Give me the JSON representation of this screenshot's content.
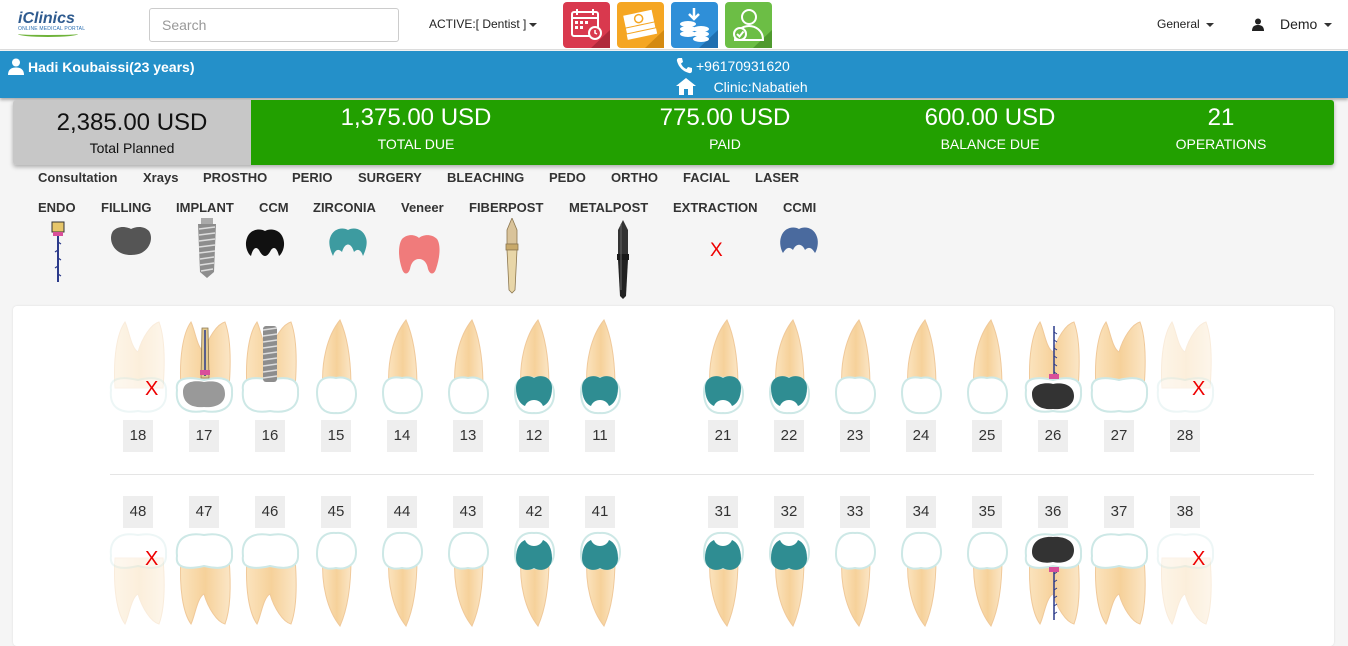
{
  "header": {
    "logo_brand": "iClinics",
    "logo_sub": "ONLINE MEDICAL PORTAL",
    "search_placeholder": "Search",
    "active_label": "ACTIVE:[ Dentist ]",
    "general_label": "General",
    "user_label": "Demo",
    "tiles": [
      {
        "name": "calendar",
        "color": "#d9394e"
      },
      {
        "name": "money",
        "color": "#f5a623"
      },
      {
        "name": "download-coins",
        "color": "#2f8fd8"
      },
      {
        "name": "user-check",
        "color": "#6cbe45"
      }
    ]
  },
  "patient": {
    "name": "Hadi Koubaissi(23 years)",
    "phone": "+96170931620",
    "clinic": "Clinic:Nabatieh"
  },
  "summary": {
    "total_planned_amount": "2,385.00 USD",
    "total_planned_label": "Total Planned",
    "cells": [
      {
        "amount": "1,375.00 USD",
        "label": "TOTAL DUE"
      },
      {
        "amount": "775.00 USD",
        "label": "PAID"
      },
      {
        "amount": "600.00 USD",
        "label": "BALANCE DUE"
      },
      {
        "amount": "21",
        "label": "OPERATIONS"
      }
    ]
  },
  "categories_row1": [
    "Consultation",
    "Xrays",
    "PROSTHO",
    "PERIO",
    "SURGERY",
    "BLEACHING",
    "PEDO",
    "ORTHO",
    "FACIAL",
    "LASER"
  ],
  "categories_row2": [
    "ENDO",
    "FILLING",
    "IMPLANT",
    "CCM",
    "ZIRCONIA",
    "Veneer",
    "FIBERPOST",
    "METALPOST",
    "EXTRACTION",
    "CCMI"
  ],
  "extraction_mark": "X",
  "colors": {
    "accent_blue": "#2490c9",
    "summary_green": "#22a000",
    "zirconia": "#3d9ba0",
    "veneer": "#f07b7b",
    "ccmi": "#4a6a9e",
    "filling": "#555555"
  },
  "upper_teeth": [
    "18",
    "17",
    "16",
    "15",
    "14",
    "13",
    "12",
    "11",
    "21",
    "22",
    "23",
    "24",
    "25",
    "26",
    "27",
    "28"
  ],
  "lower_teeth": [
    "48",
    "47",
    "46",
    "45",
    "44",
    "43",
    "42",
    "41",
    "31",
    "32",
    "33",
    "34",
    "35",
    "36",
    "37",
    "38"
  ]
}
